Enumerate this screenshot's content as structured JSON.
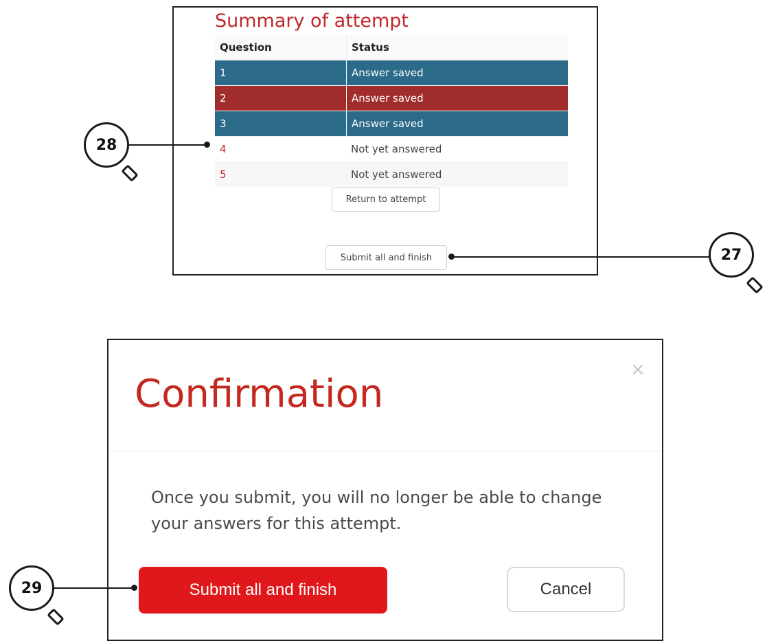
{
  "summary": {
    "title": "Summary of attempt",
    "columns": [
      "Question",
      "Status"
    ],
    "rows": [
      {
        "question": "1",
        "status": "Answer saved",
        "style": "blue"
      },
      {
        "question": "2",
        "status": "Answer saved",
        "style": "red"
      },
      {
        "question": "3",
        "status": "Answer saved",
        "style": "blue"
      },
      {
        "question": "4",
        "status": "Not yet answered",
        "style": "plain"
      },
      {
        "question": "5",
        "status": "Not yet answered",
        "style": "alt"
      }
    ],
    "return_label": "Return to attempt",
    "submit_label": "Submit all and finish"
  },
  "dialog": {
    "title": "Confirmation",
    "close_glyph": "×",
    "message": "Once you submit, you will no longer be able to change your answers for this attempt.",
    "confirm_label": "Submit all and finish",
    "cancel_label": "Cancel"
  },
  "callouts": {
    "c27": "27",
    "c28": "28",
    "c29": "29"
  },
  "colors": {
    "accent_red": "#c0282c",
    "row_blue": "#2b6a89",
    "row_red": "#a02c2c",
    "confirm_button": "#e1181b"
  },
  "icons": {
    "callout": "magnifier-icon",
    "close": "close-icon"
  }
}
